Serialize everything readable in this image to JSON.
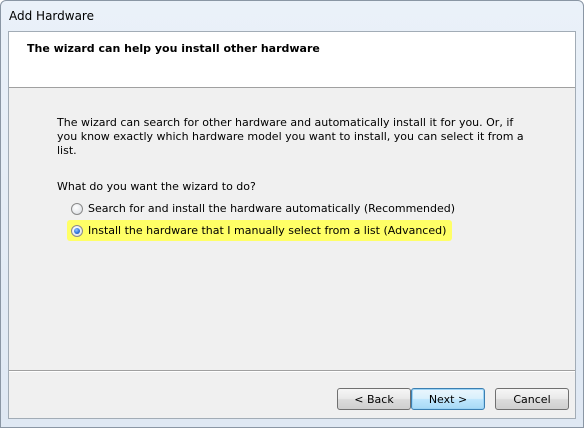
{
  "window": {
    "title": "Add Hardware"
  },
  "header": {
    "title": "The wizard can help you install other hardware"
  },
  "body": {
    "description": "The wizard can search for other hardware and automatically install it for you. Or, if you know exactly which hardware model you want to install, you can select it from a list.",
    "question": "What do you want the wizard to do?",
    "options": [
      {
        "label": "Search for and install the hardware automatically (Recommended)",
        "selected": false
      },
      {
        "label": "Install the hardware that I manually select from a list (Advanced)",
        "selected": true
      }
    ],
    "highlight_color": "#ffff66"
  },
  "buttons": {
    "back": "< Back",
    "next": "Next >",
    "cancel": "Cancel"
  }
}
